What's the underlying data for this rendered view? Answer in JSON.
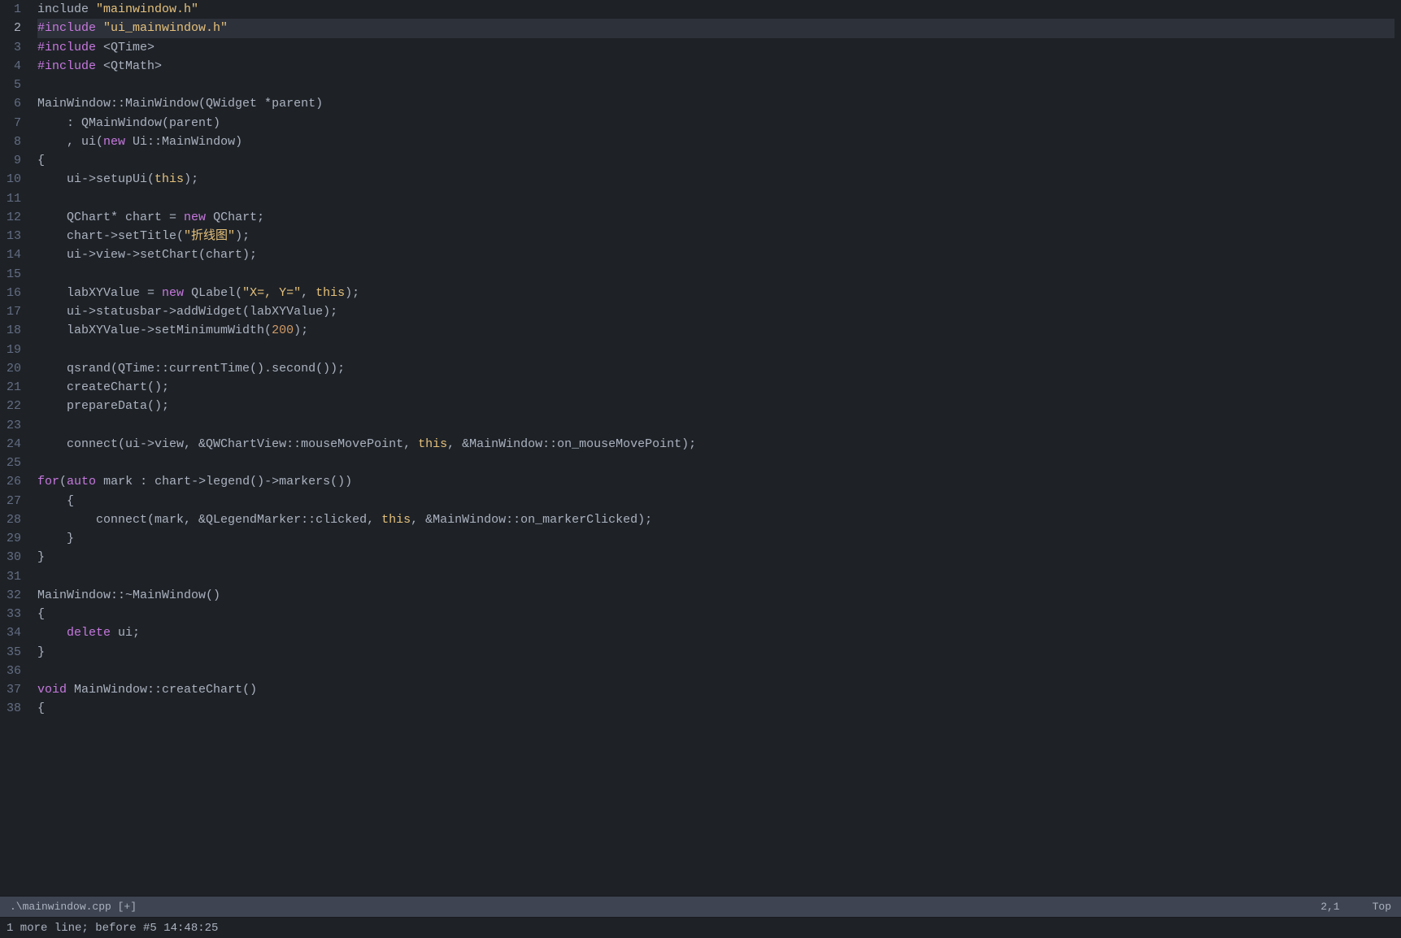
{
  "editor": {
    "filename": ".\\mainwindow.cpp [+]",
    "cursor_position": "2,1",
    "scroll_position": "Top",
    "message": "1 more line; before #5  14:48:25"
  },
  "lines": [
    {
      "num": 1,
      "active": false,
      "tokens": [
        {
          "t": "normal",
          "v": "include "
        },
        {
          "t": "str",
          "v": "\"mainwindow.h\""
        }
      ]
    },
    {
      "num": 2,
      "active": true,
      "tokens": [
        {
          "t": "hash",
          "v": "#include "
        },
        {
          "t": "str",
          "v": "\"ui_mainwindow.h\""
        }
      ]
    },
    {
      "num": 3,
      "active": false,
      "tokens": [
        {
          "t": "hash",
          "v": "#include "
        },
        {
          "t": "normal",
          "v": "<QTime>"
        }
      ]
    },
    {
      "num": 4,
      "active": false,
      "tokens": [
        {
          "t": "hash",
          "v": "#include "
        },
        {
          "t": "normal",
          "v": "<QtMath>"
        }
      ]
    },
    {
      "num": 5,
      "active": false,
      "tokens": []
    },
    {
      "num": 6,
      "active": false,
      "tokens": [
        {
          "t": "normal",
          "v": "MainWindow::MainWindow(QWidget *parent)"
        }
      ]
    },
    {
      "num": 7,
      "active": false,
      "tokens": [
        {
          "t": "normal",
          "v": "    : QMainWindow(parent)"
        }
      ]
    },
    {
      "num": 8,
      "active": false,
      "tokens": [
        {
          "t": "normal",
          "v": "    , ui("
        },
        {
          "t": "new-kw",
          "v": "new"
        },
        {
          "t": "normal",
          "v": " Ui::MainWindow)"
        }
      ]
    },
    {
      "num": 9,
      "active": false,
      "tokens": [
        {
          "t": "normal",
          "v": "{"
        }
      ]
    },
    {
      "num": 10,
      "active": false,
      "tokens": [
        {
          "t": "normal",
          "v": "    ui->setupUi("
        },
        {
          "t": "this-kw",
          "v": "this"
        },
        {
          "t": "normal",
          "v": ");"
        }
      ]
    },
    {
      "num": 11,
      "active": false,
      "tokens": []
    },
    {
      "num": 12,
      "active": false,
      "tokens": [
        {
          "t": "normal",
          "v": "    QChart* chart = "
        },
        {
          "t": "new-kw",
          "v": "new"
        },
        {
          "t": "normal",
          "v": " QChart;"
        }
      ]
    },
    {
      "num": 13,
      "active": false,
      "tokens": [
        {
          "t": "normal",
          "v": "    chart->setTitle("
        },
        {
          "t": "str",
          "v": "\"折线图\""
        },
        {
          "t": "normal",
          "v": ");"
        }
      ]
    },
    {
      "num": 14,
      "active": false,
      "tokens": [
        {
          "t": "normal",
          "v": "    ui->view->setChart(chart);"
        }
      ]
    },
    {
      "num": 15,
      "active": false,
      "tokens": []
    },
    {
      "num": 16,
      "active": false,
      "tokens": [
        {
          "t": "normal",
          "v": "    labXYValue = "
        },
        {
          "t": "new-kw",
          "v": "new"
        },
        {
          "t": "normal",
          "v": " QLabel("
        },
        {
          "t": "str",
          "v": "\"X=, Y=\""
        },
        {
          "t": "normal",
          "v": ", "
        },
        {
          "t": "this-kw",
          "v": "this"
        },
        {
          "t": "normal",
          "v": ");"
        }
      ]
    },
    {
      "num": 17,
      "active": false,
      "tokens": [
        {
          "t": "normal",
          "v": "    ui->statusbar->addWidget(labXYValue);"
        }
      ]
    },
    {
      "num": 18,
      "active": false,
      "tokens": [
        {
          "t": "normal",
          "v": "    labXYValue->setMinimumWidth("
        },
        {
          "t": "num",
          "v": "200"
        },
        {
          "t": "normal",
          "v": ");"
        }
      ]
    },
    {
      "num": 19,
      "active": false,
      "tokens": []
    },
    {
      "num": 20,
      "active": false,
      "tokens": [
        {
          "t": "normal",
          "v": "    qsrand(QTime::currentTime().second());"
        }
      ]
    },
    {
      "num": 21,
      "active": false,
      "tokens": [
        {
          "t": "normal",
          "v": "    createChart();"
        }
      ]
    },
    {
      "num": 22,
      "active": false,
      "tokens": [
        {
          "t": "normal",
          "v": "    prepareData();"
        }
      ]
    },
    {
      "num": 23,
      "active": false,
      "tokens": []
    },
    {
      "num": 24,
      "active": false,
      "tokens": [
        {
          "t": "normal",
          "v": "    connect(ui->view, &QWChartView::mouseMovePoint, "
        },
        {
          "t": "this-kw",
          "v": "this"
        },
        {
          "t": "normal",
          "v": ", &MainWindow::on_mouseMovePoint);"
        }
      ]
    },
    {
      "num": 25,
      "active": false,
      "tokens": []
    },
    {
      "num": 26,
      "active": false,
      "tokens": [
        {
          "t": "for-kw",
          "v": "for"
        },
        {
          "t": "normal",
          "v": "("
        },
        {
          "t": "auto-kw",
          "v": "auto"
        },
        {
          "t": "normal",
          "v": " mark : chart->legend()->markers())"
        }
      ]
    },
    {
      "num": 27,
      "active": false,
      "tokens": [
        {
          "t": "normal",
          "v": "    {"
        }
      ]
    },
    {
      "num": 28,
      "active": false,
      "tokens": [
        {
          "t": "normal",
          "v": "        connect(mark, &QLegendMarker::clicked, "
        },
        {
          "t": "this-kw",
          "v": "this"
        },
        {
          "t": "normal",
          "v": ", &MainWindow::on_markerClicked);"
        }
      ]
    },
    {
      "num": 29,
      "active": false,
      "tokens": [
        {
          "t": "normal",
          "v": "    }"
        }
      ]
    },
    {
      "num": 30,
      "active": false,
      "tokens": [
        {
          "t": "normal",
          "v": "}"
        }
      ]
    },
    {
      "num": 31,
      "active": false,
      "tokens": []
    },
    {
      "num": 32,
      "active": false,
      "tokens": [
        {
          "t": "normal",
          "v": "MainWindow::~MainWindow()"
        }
      ]
    },
    {
      "num": 33,
      "active": false,
      "tokens": [
        {
          "t": "normal",
          "v": "{"
        }
      ]
    },
    {
      "num": 34,
      "active": false,
      "tokens": [
        {
          "t": "normal",
          "v": "    "
        },
        {
          "t": "delete-kw",
          "v": "delete"
        },
        {
          "t": "normal",
          "v": " ui;"
        }
      ]
    },
    {
      "num": 35,
      "active": false,
      "tokens": [
        {
          "t": "normal",
          "v": "}"
        }
      ]
    },
    {
      "num": 36,
      "active": false,
      "tokens": []
    },
    {
      "num": 37,
      "active": false,
      "tokens": [
        {
          "t": "void-kw",
          "v": "void"
        },
        {
          "t": "normal",
          "v": " MainWindow::createChart()"
        }
      ]
    },
    {
      "num": 38,
      "active": false,
      "tokens": [
        {
          "t": "normal",
          "v": "{"
        }
      ]
    }
  ]
}
